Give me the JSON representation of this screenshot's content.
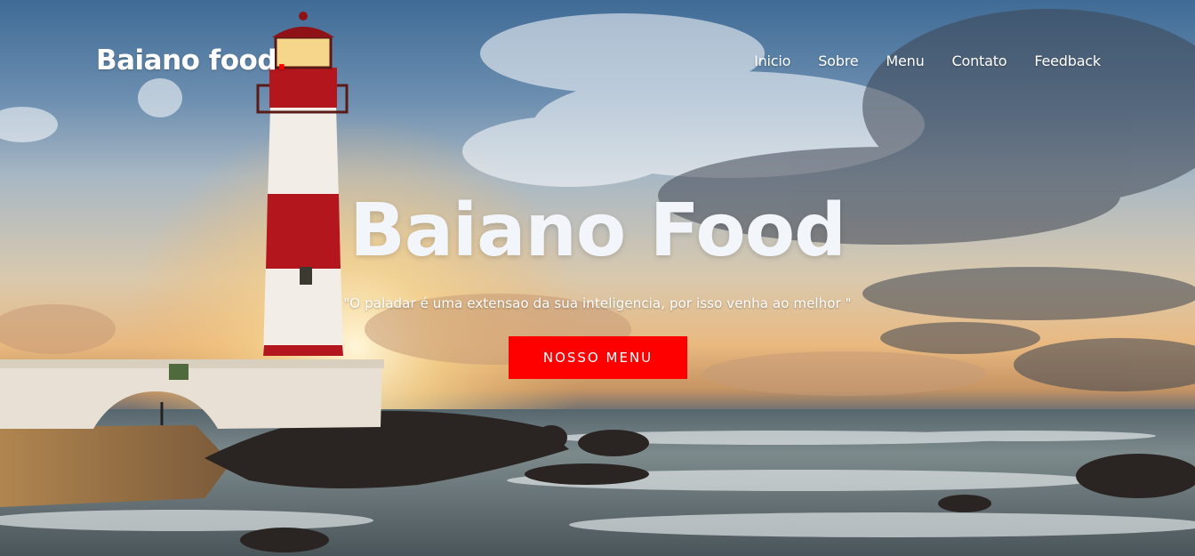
{
  "brand": {
    "name": "Baiano food",
    "dot": ".",
    "accent": "#ff0000"
  },
  "nav": {
    "items": [
      {
        "label": "Inicio"
      },
      {
        "label": "Sobre"
      },
      {
        "label": "Menu"
      },
      {
        "label": "Contato"
      },
      {
        "label": "Feedback"
      }
    ]
  },
  "hero": {
    "title": "Baiano Food",
    "subtitle": "\"O paladar é uma extensao da sua inteligencia, por isso venha ao melhor \"",
    "cta_label": "NOSSO MENU",
    "cta_color": "#ff0000",
    "background": "lighthouse-beach-sunset-photo"
  }
}
